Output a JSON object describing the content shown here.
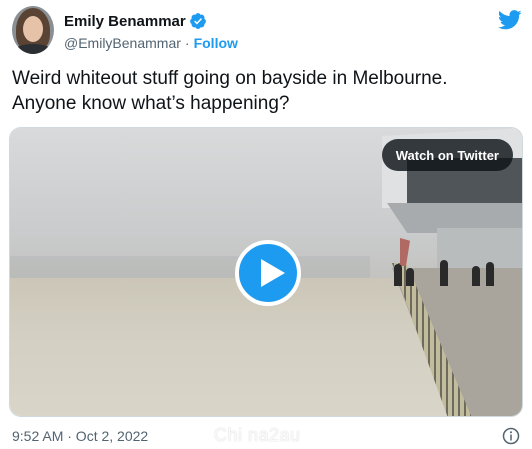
{
  "author": {
    "display_name": "Emily Benammar",
    "handle": "@EmilyBenammar",
    "separator": "·",
    "follow_label": "Follow"
  },
  "tweet": {
    "text_line1": "Weird whiteout stuff going on bayside in Melbourne.",
    "text_line2": "Anyone know what’s happening?"
  },
  "media": {
    "watch_label": "Watch on Twitter",
    "play_icon": "play-icon"
  },
  "footer": {
    "timestamp": "9:52 AM · Oct 2, 2022",
    "watermark": "Chi na2au",
    "info_icon": "info-icon"
  },
  "colors": {
    "accent": "#1d9bf0",
    "text": "#0f1419",
    "secondary": "#536471"
  }
}
